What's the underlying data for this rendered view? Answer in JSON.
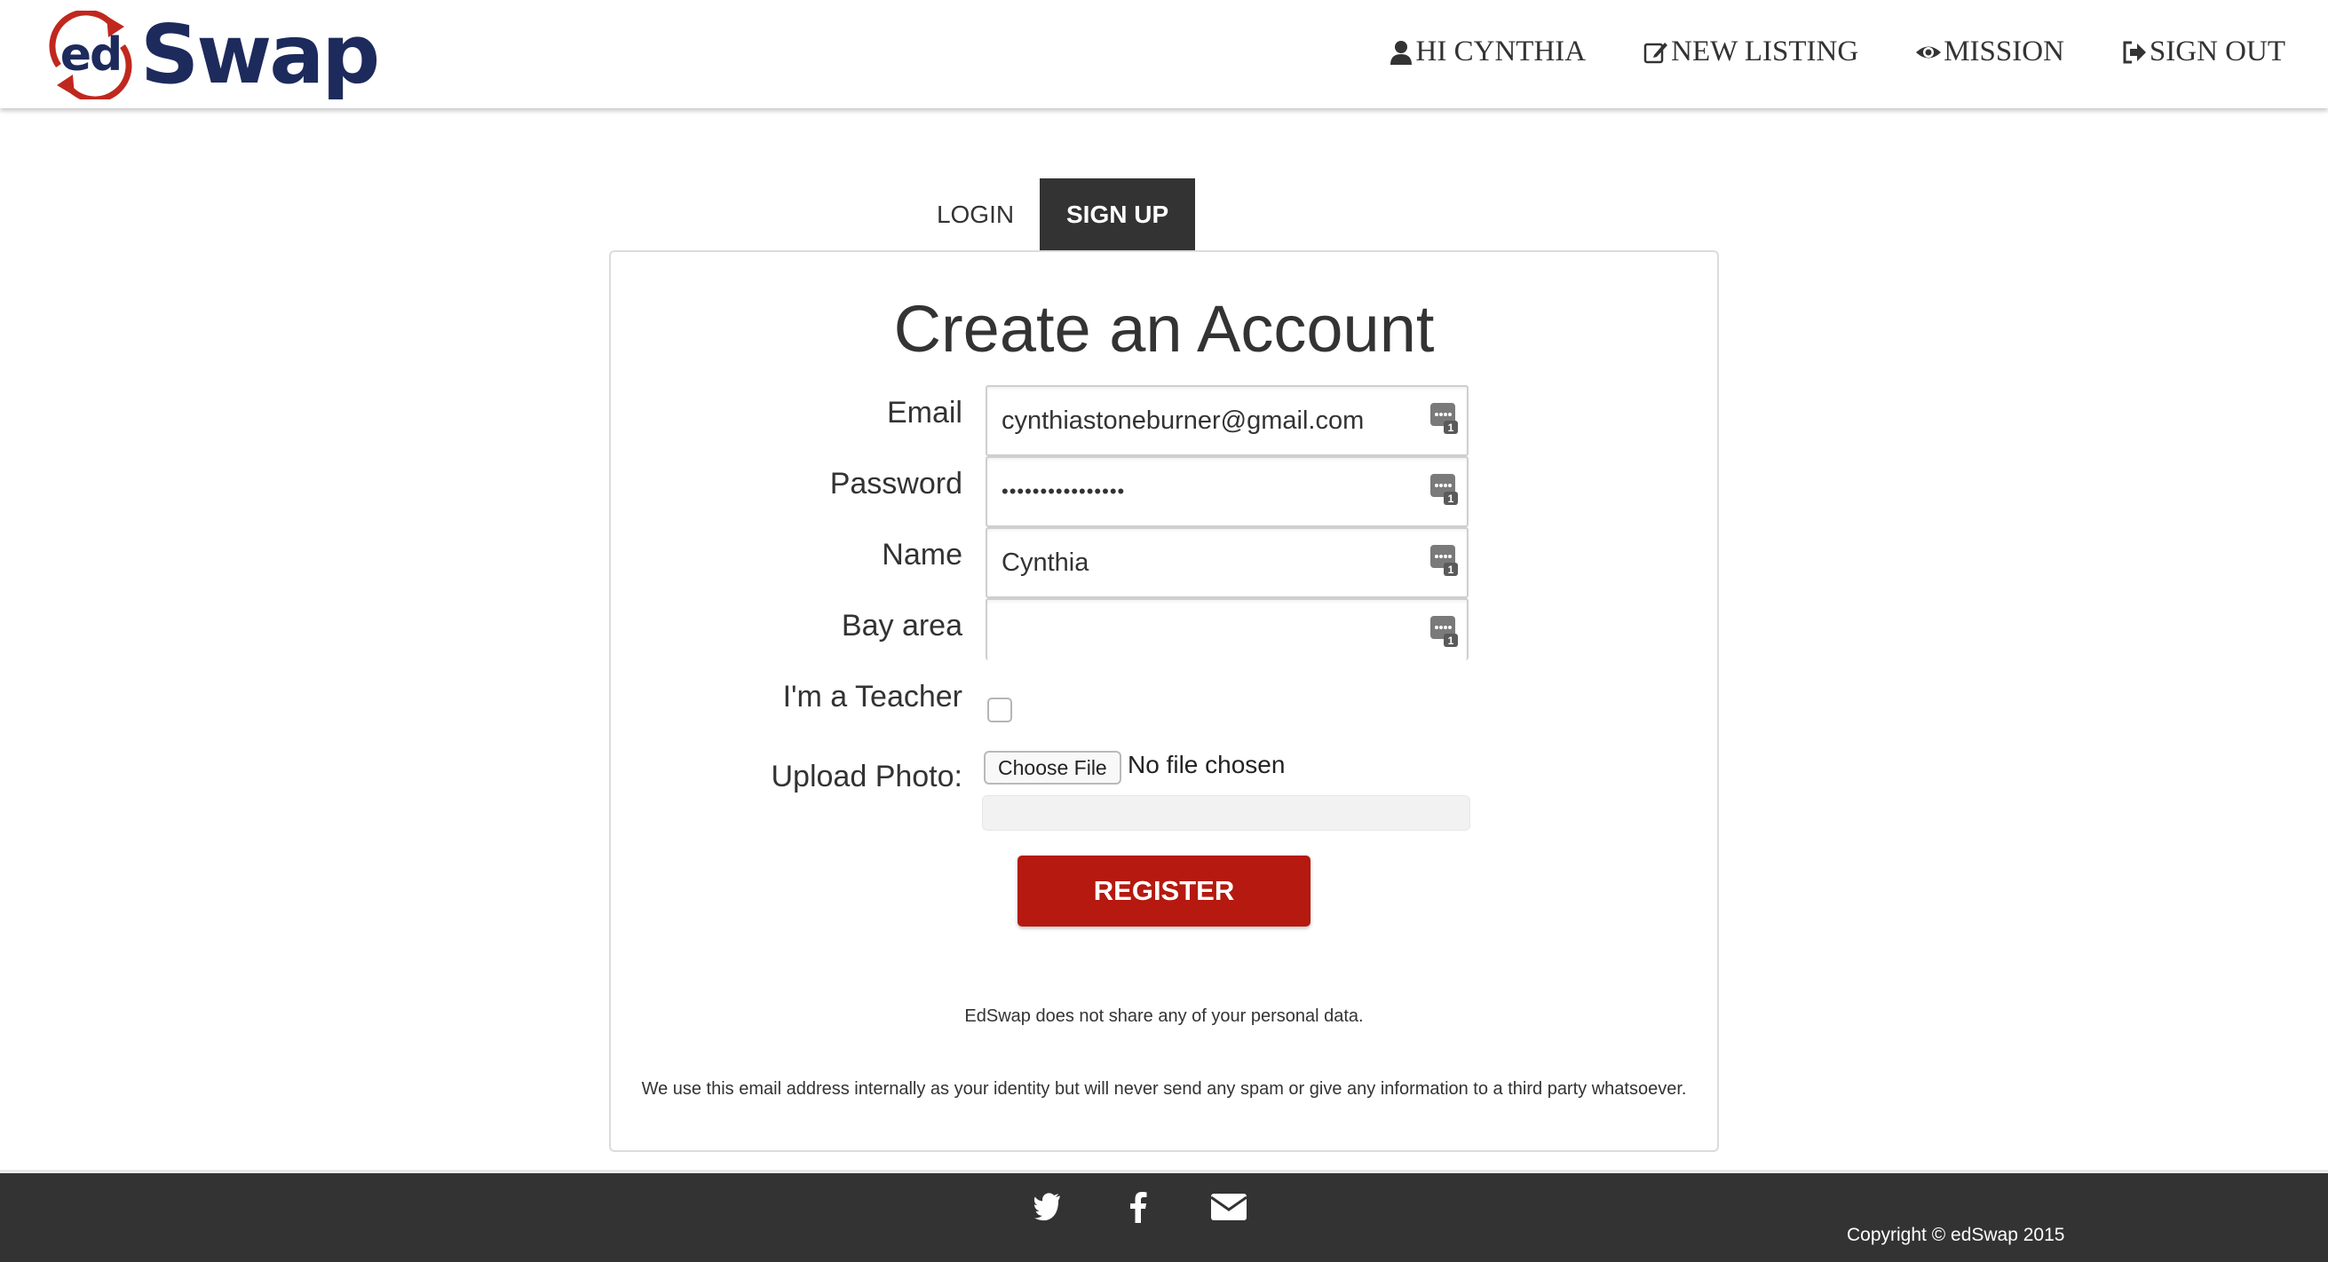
{
  "brand": {
    "logo_ed": "ed",
    "logo_swap": "Swap"
  },
  "nav": {
    "items": [
      {
        "label": "HI CYNTHIA",
        "icon": "user-icon"
      },
      {
        "label": "NEW LISTING",
        "icon": "edit-icon"
      },
      {
        "label": "MISSION",
        "icon": "eye-icon"
      },
      {
        "label": "SIGN OUT",
        "icon": "sign-out-icon"
      }
    ]
  },
  "tabs": {
    "login": "LOGIN",
    "signup": "SIGN UP",
    "active": "signup"
  },
  "form": {
    "title": "Create an Account",
    "fields": {
      "email": {
        "label": "Email",
        "value": "cynthiastoneburner@gmail.com"
      },
      "password": {
        "label": "Password",
        "value": "••••••••••••••••"
      },
      "name": {
        "label": "Name",
        "value": "Cynthia"
      },
      "bay_area": {
        "label": "Bay area",
        "value": ""
      }
    },
    "teacher": {
      "label": "I'm a Teacher",
      "checked": false
    },
    "upload": {
      "label": "Upload Photo:",
      "button": "Choose File",
      "status": "No file chosen"
    },
    "register_label": "REGISTER",
    "note_privacy": "EdSwap does not share any of your personal data.",
    "note_email": "We use this email address internally as your identity but will never send any spam or give any information to a third party whatsoever."
  },
  "footer": {
    "social": [
      "twitter-icon",
      "facebook-icon",
      "envelope-icon"
    ],
    "copyright": "Copyright © edSwap 2015"
  },
  "colors": {
    "brand_navy": "#1d2a5c",
    "brand_red": "#c0281e",
    "register": "#b5190f",
    "footer": "#333333",
    "active_tab": "#333333"
  }
}
